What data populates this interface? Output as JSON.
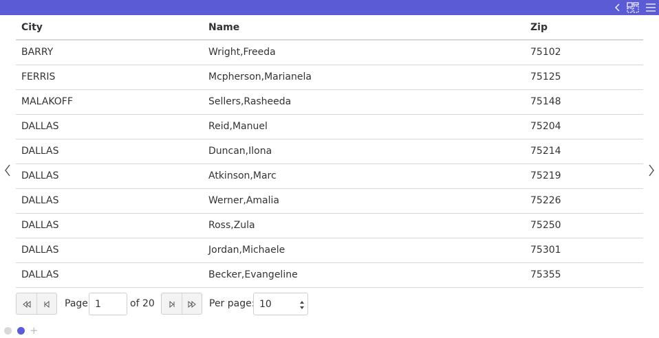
{
  "colors": {
    "accent": "#5b5bd6",
    "border": "#d8d8d8",
    "text": "#333333"
  },
  "toolbar": {
    "icons": [
      "chevron-left-icon",
      "layout-icon",
      "hamburger-menu-icon"
    ]
  },
  "table": {
    "columns": [
      "City",
      "Name",
      "Zip"
    ],
    "rows": [
      [
        "BARRY",
        "Wright,Freeda",
        "75102"
      ],
      [
        "FERRIS",
        "Mcpherson,Marianela",
        "75125"
      ],
      [
        "MALAKOFF",
        "Sellers,Rasheeda",
        "75148"
      ],
      [
        "DALLAS",
        "Reid,Manuel",
        "75204"
      ],
      [
        "DALLAS",
        "Duncan,Ilona",
        "75214"
      ],
      [
        "DALLAS",
        "Atkinson,Marc",
        "75219"
      ],
      [
        "DALLAS",
        "Werner,Amalia",
        "75226"
      ],
      [
        "DALLAS",
        "Ross,Zula",
        "75250"
      ],
      [
        "DALLAS",
        "Jordan,Michaele",
        "75301"
      ],
      [
        "DALLAS",
        "Becker,Evangeline",
        "75355"
      ]
    ]
  },
  "pager": {
    "page_label": "Page",
    "page_value": "1",
    "of_label": "of 20",
    "per_page_label": "Per page:",
    "per_page_value": "10"
  },
  "carousel": {
    "pages": 2,
    "active_page": 2
  }
}
